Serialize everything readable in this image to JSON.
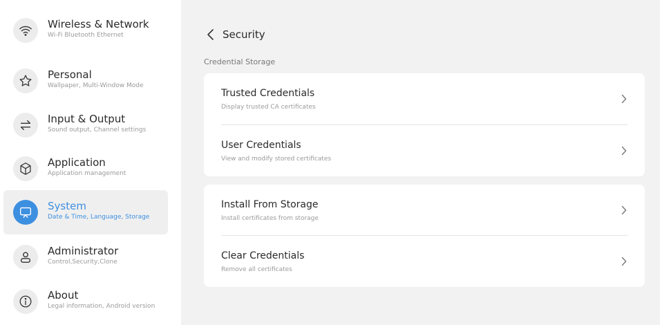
{
  "sidebar": {
    "items": [
      {
        "label": "Wireless & Network",
        "sub": "Wi-Fi Bluetooth Ethernet",
        "icon": "wifi-icon"
      },
      {
        "label": "Personal",
        "sub": "Wallpaper, Multi-Window Mode",
        "icon": "star-icon"
      },
      {
        "label": "Input & Output",
        "sub": "Sound output, Channel settings",
        "icon": "swap-arrows-icon"
      },
      {
        "label": "Application",
        "sub": "Application management",
        "icon": "cube-icon"
      },
      {
        "label": "System",
        "sub": "Date & Time, Language, Storage",
        "icon": "monitor-icon",
        "active": true
      },
      {
        "label": "Administrator",
        "sub": "Control,Security,Clone",
        "icon": "user-icon"
      },
      {
        "label": "About",
        "sub": "Legal information, Android version",
        "icon": "info-icon"
      }
    ]
  },
  "main": {
    "title": "Security",
    "section_label": "Credential Storage",
    "cards": [
      {
        "rows": [
          {
            "title": "Trusted Credentials",
            "sub": "Display trusted CA certificates"
          },
          {
            "title": "User Credentials",
            "sub": "View and modify stored certificates"
          }
        ]
      },
      {
        "rows": [
          {
            "title": "Install From Storage",
            "sub": "Install certificates from storage"
          },
          {
            "title": "Clear Credentials",
            "sub": "Remove all certificates"
          }
        ]
      }
    ]
  },
  "colors": {
    "accent": "#3d8fe0",
    "sidebar_active_bg": "#efefef",
    "main_bg": "#f2f2f2",
    "card_bg": "#ffffff"
  }
}
